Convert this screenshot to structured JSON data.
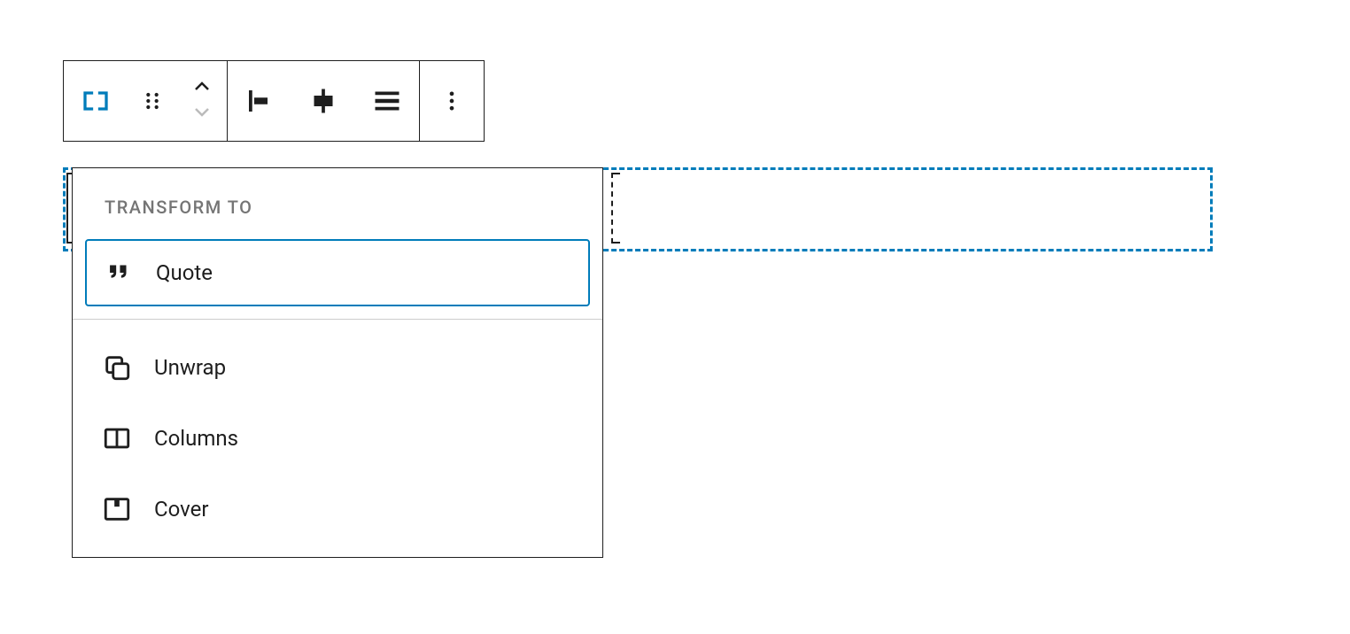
{
  "popover": {
    "header": "Transform to",
    "items": [
      {
        "label": "Quote",
        "selected": true
      },
      {
        "label": "Unwrap",
        "selected": false
      },
      {
        "label": "Columns",
        "selected": false
      },
      {
        "label": "Cover",
        "selected": false
      }
    ]
  },
  "colors": {
    "accent": "#007cba"
  }
}
